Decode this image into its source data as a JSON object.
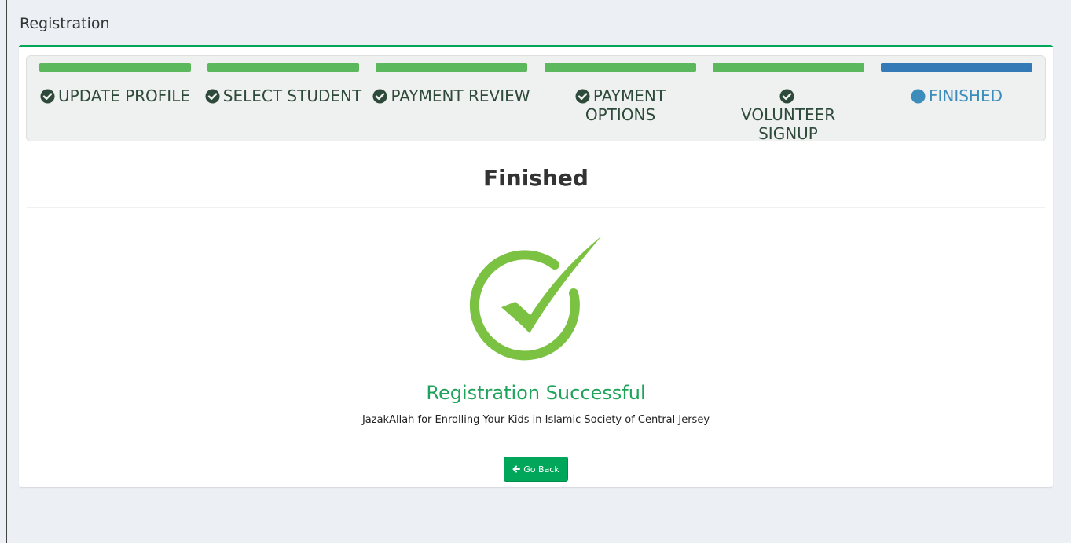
{
  "page": {
    "title": "Registration"
  },
  "colors": {
    "done": "#5cb85c",
    "active": "#337ab7",
    "success": "#1fa35a",
    "button": "#00a65a"
  },
  "wizard": {
    "steps": [
      {
        "label": "UPDATE PROFILE",
        "state": "done",
        "icon": "check-circle-icon"
      },
      {
        "label": "SELECT STUDENT",
        "state": "done",
        "icon": "check-circle-icon"
      },
      {
        "label": "PAYMENT REVIEW",
        "state": "done",
        "icon": "check-circle-icon"
      },
      {
        "label": "PAYMENT OPTIONS",
        "state": "done",
        "icon": "check-circle-icon"
      },
      {
        "label": "VOLUNTEER SIGNUP",
        "state": "done",
        "icon": "check-circle-icon"
      },
      {
        "label": "FINISHED",
        "state": "active",
        "icon": "dot-circle-icon"
      }
    ]
  },
  "content": {
    "heading": "Finished",
    "success_icon": "big-check-icon",
    "success_title": "Registration Successful",
    "message": "JazakAllah for Enrolling Your Kids in Islamic Society of Central Jersey",
    "back_button": "Go Back",
    "back_icon": "arrow-left-icon"
  }
}
